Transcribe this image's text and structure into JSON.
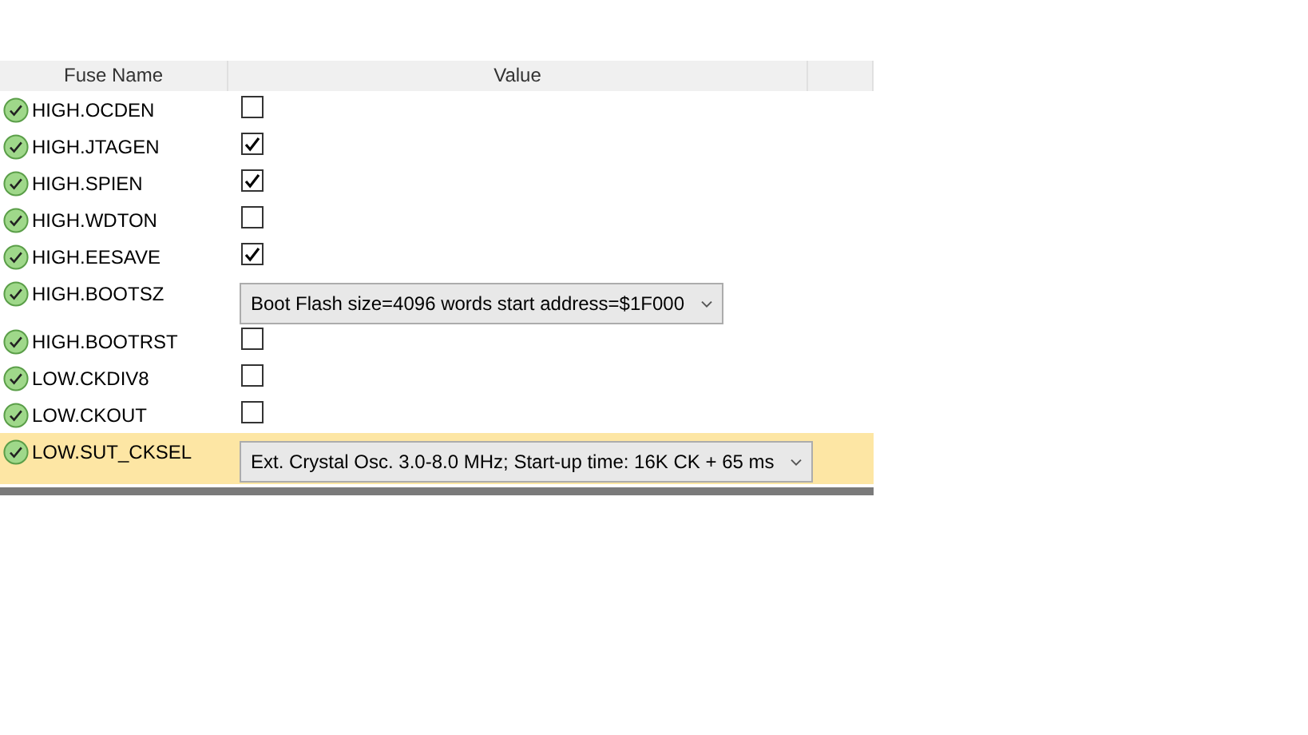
{
  "table": {
    "columns": [
      "Fuse Name",
      "Value"
    ],
    "rows": [
      {
        "name": "HIGH.OCDEN",
        "kind": "checkbox",
        "checked": false,
        "selected": false
      },
      {
        "name": "HIGH.JTAGEN",
        "kind": "checkbox",
        "checked": true,
        "selected": false
      },
      {
        "name": "HIGH.SPIEN",
        "kind": "checkbox",
        "checked": true,
        "selected": false
      },
      {
        "name": "HIGH.WDTON",
        "kind": "checkbox",
        "checked": false,
        "selected": false
      },
      {
        "name": "HIGH.EESAVE",
        "kind": "checkbox",
        "checked": true,
        "selected": false
      },
      {
        "name": "HIGH.BOOTSZ",
        "kind": "combo",
        "value": "Boot Flash size=4096 words start address=$1F000",
        "selected": false
      },
      {
        "name": "HIGH.BOOTRST",
        "kind": "checkbox",
        "checked": false,
        "selected": false
      },
      {
        "name": "LOW.CKDIV8",
        "kind": "checkbox",
        "checked": false,
        "selected": false
      },
      {
        "name": "LOW.CKOUT",
        "kind": "checkbox",
        "checked": false,
        "selected": false
      },
      {
        "name": "LOW.SUT_CKSEL",
        "kind": "combo",
        "value": "Ext. Crystal Osc. 3.0-8.0 MHz; Start-up time: 16K CK + 65 ms",
        "selected": true
      }
    ]
  }
}
